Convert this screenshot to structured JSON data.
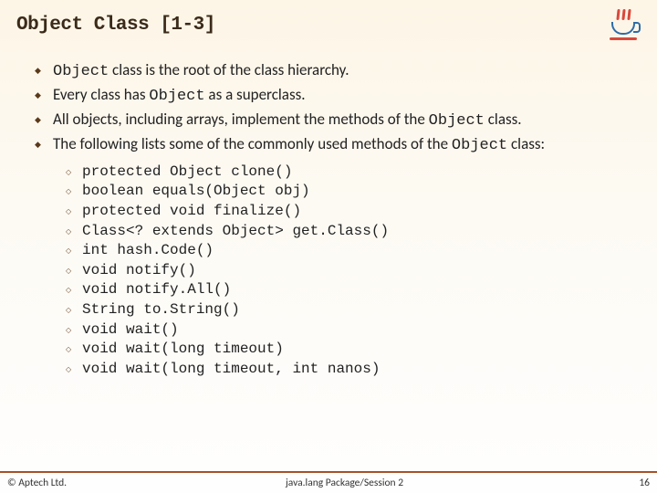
{
  "title": "Object Class [1-3]",
  "bullets": [
    {
      "pre": "Object",
      "post": " class is the root of the class hierarchy."
    },
    {
      "pre": "",
      "mid": "Every class has ",
      "mono": "Object",
      "post": " as a superclass."
    },
    {
      "pre": "",
      "mid": "All objects, including arrays, implement the methods of the ",
      "mono": "Object",
      "post": " class."
    },
    {
      "pre": "",
      "mid": "The following lists some of the commonly used methods of the ",
      "mono": "Object",
      "post": " class:"
    }
  ],
  "methods": [
    "protected Object clone()",
    "boolean equals(Object obj)",
    "protected void finalize()",
    "Class<? extends Object> get.Class()",
    "int hash.Code()",
    "void notify()",
    "void notify.All()",
    "String to.String()",
    "void wait()",
    "void wait(long timeout)",
    "void wait(long timeout, int nanos)"
  ],
  "footer": {
    "copyright": "© Aptech Ltd.",
    "center": "java.lang Package/Session 2",
    "page": "16"
  }
}
